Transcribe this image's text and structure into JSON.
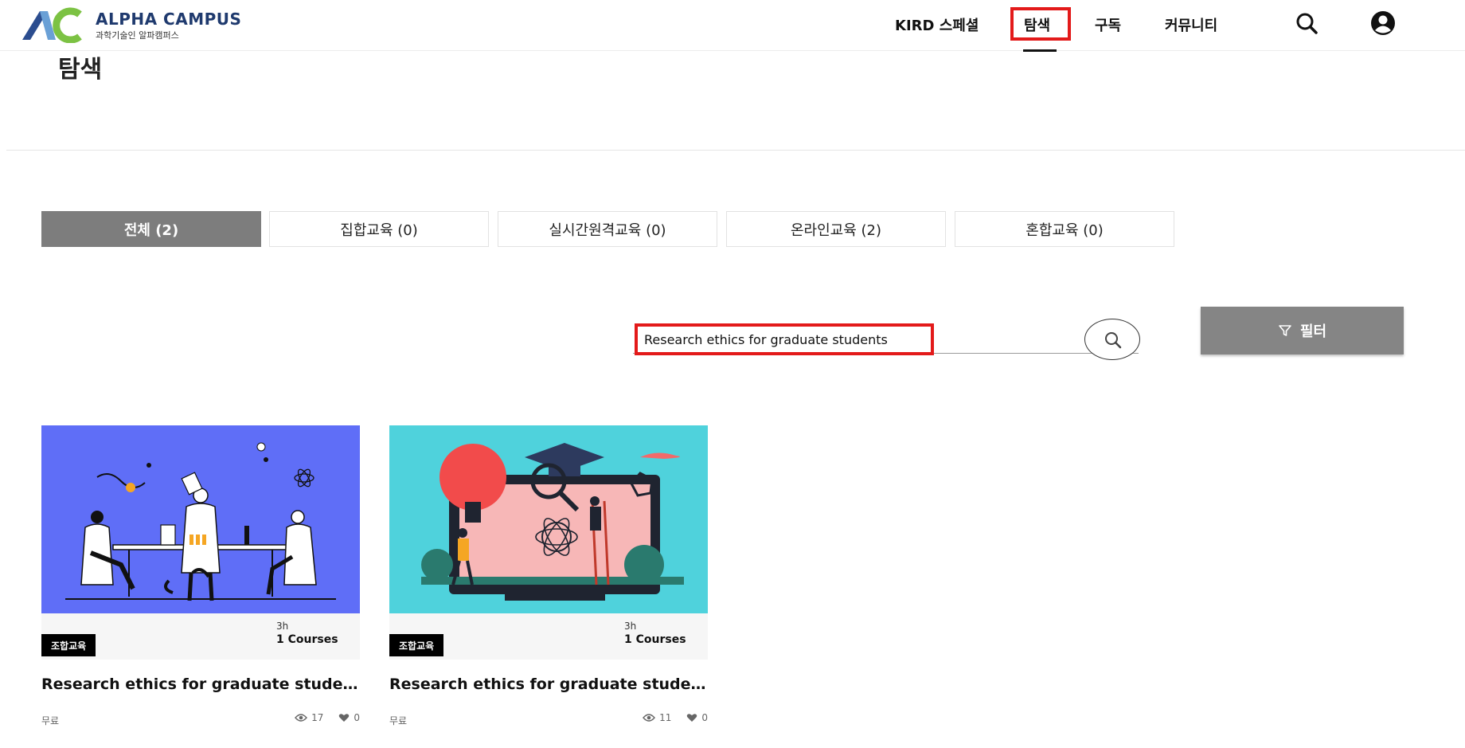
{
  "header": {
    "logo_title": "ALPHA CAMPUS",
    "logo_subtitle": "과학기술인 알파캠퍼스",
    "nav": [
      "KIRD 스페셜",
      "탐색",
      "구독",
      "커뮤니티"
    ],
    "active_nav_index": 1,
    "icons": [
      "search-icon",
      "user-account-icon"
    ]
  },
  "page": {
    "title": "탐색"
  },
  "tabs": [
    {
      "label": "전체 (2)",
      "active": true
    },
    {
      "label": "집합교육 (0)",
      "active": false
    },
    {
      "label": "실시간원격교육 (0)",
      "active": false
    },
    {
      "label": "온라인교육 (2)",
      "active": false
    },
    {
      "label": "혼합교육 (0)",
      "active": false
    }
  ],
  "search": {
    "value": "Research ethics for graduate students",
    "button_icon": "search-icon"
  },
  "filter": {
    "label": "필터",
    "icon": "funnel-icon"
  },
  "cards": [
    {
      "badge": "조합교육",
      "duration": "3h",
      "courses": "1 Courses",
      "title": "Research ethics for graduate studen…",
      "price": "무료",
      "views": "17",
      "likes": "0",
      "image_bg": "#5f6ef7"
    },
    {
      "badge": "조합교육",
      "duration": "3h",
      "courses": "1 Courses",
      "title": "Research ethics for graduate studen…",
      "price": "무료",
      "views": "11",
      "likes": "0",
      "image_bg": "#4fd2dc"
    }
  ],
  "colors": {
    "accent_highlight": "#e31a1a",
    "active_tab": "#7d7d7d",
    "filter_button": "#858585",
    "logo_blue": "#1f3a6e"
  }
}
